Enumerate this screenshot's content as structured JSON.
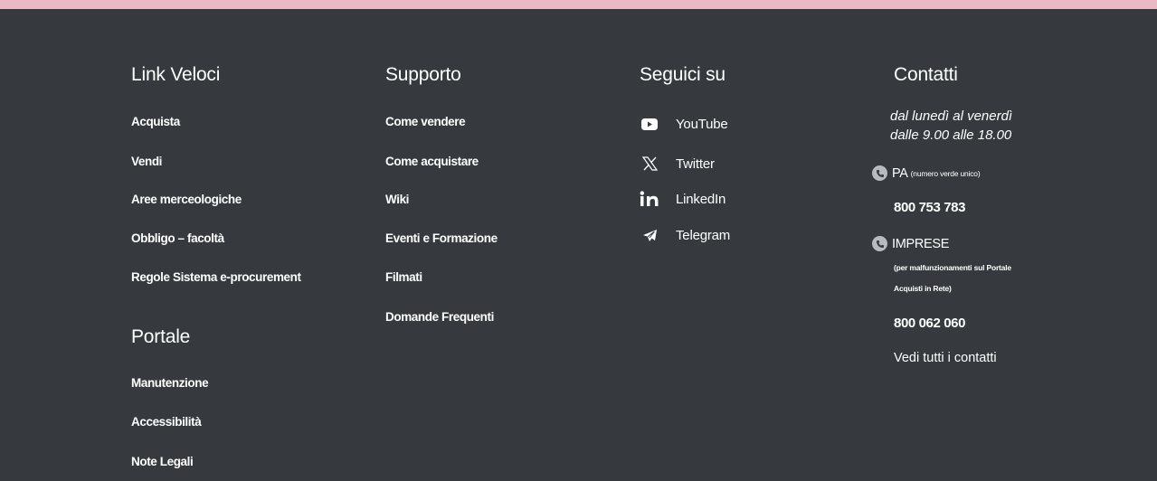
{
  "colors": {
    "background": "#36393e",
    "top_bar": "#eab9c4",
    "text": "#ffffff"
  },
  "link_veloci": {
    "heading": "Link Veloci",
    "items": [
      "Acquista",
      "Vendi",
      "Aree merceologiche",
      "Obbligo – facoltà",
      "Regole Sistema e-procurement"
    ]
  },
  "portale": {
    "heading": "Portale",
    "items": [
      "Manutenzione",
      "Accessibilità",
      "Note Legali"
    ]
  },
  "supporto": {
    "heading": "Supporto",
    "items": [
      "Come vendere",
      "Come acquistare",
      "Wiki",
      "Eventi e Formazione",
      "Filmati",
      "Domande Frequenti"
    ]
  },
  "seguici": {
    "heading": "Seguici su",
    "items": [
      {
        "label": "YouTube",
        "icon": "youtube-icon"
      },
      {
        "label": "Twitter",
        "icon": "x-twitter-icon"
      },
      {
        "label": "LinkedIn",
        "icon": "linkedin-icon"
      },
      {
        "label": "Telegram",
        "icon": "telegram-icon"
      }
    ]
  },
  "contatti": {
    "heading": "Contatti",
    "hours_line1": "dal lunedì al venerdì",
    "hours_line2": "dalle 9.00 alle 18.00",
    "pa_label": "PA",
    "pa_note": "(numero verde unico)",
    "pa_number": "800 753 783",
    "imprese_label": "IMPRESE",
    "imprese_note_line1": "(per malfunzionamenti sul Portale",
    "imprese_note_line2": "Acquisti in Rete)",
    "imprese_number": "800 062 060",
    "all_contacts": "Vedi tutti i contatti",
    "phone_icon": "phone-icon"
  }
}
